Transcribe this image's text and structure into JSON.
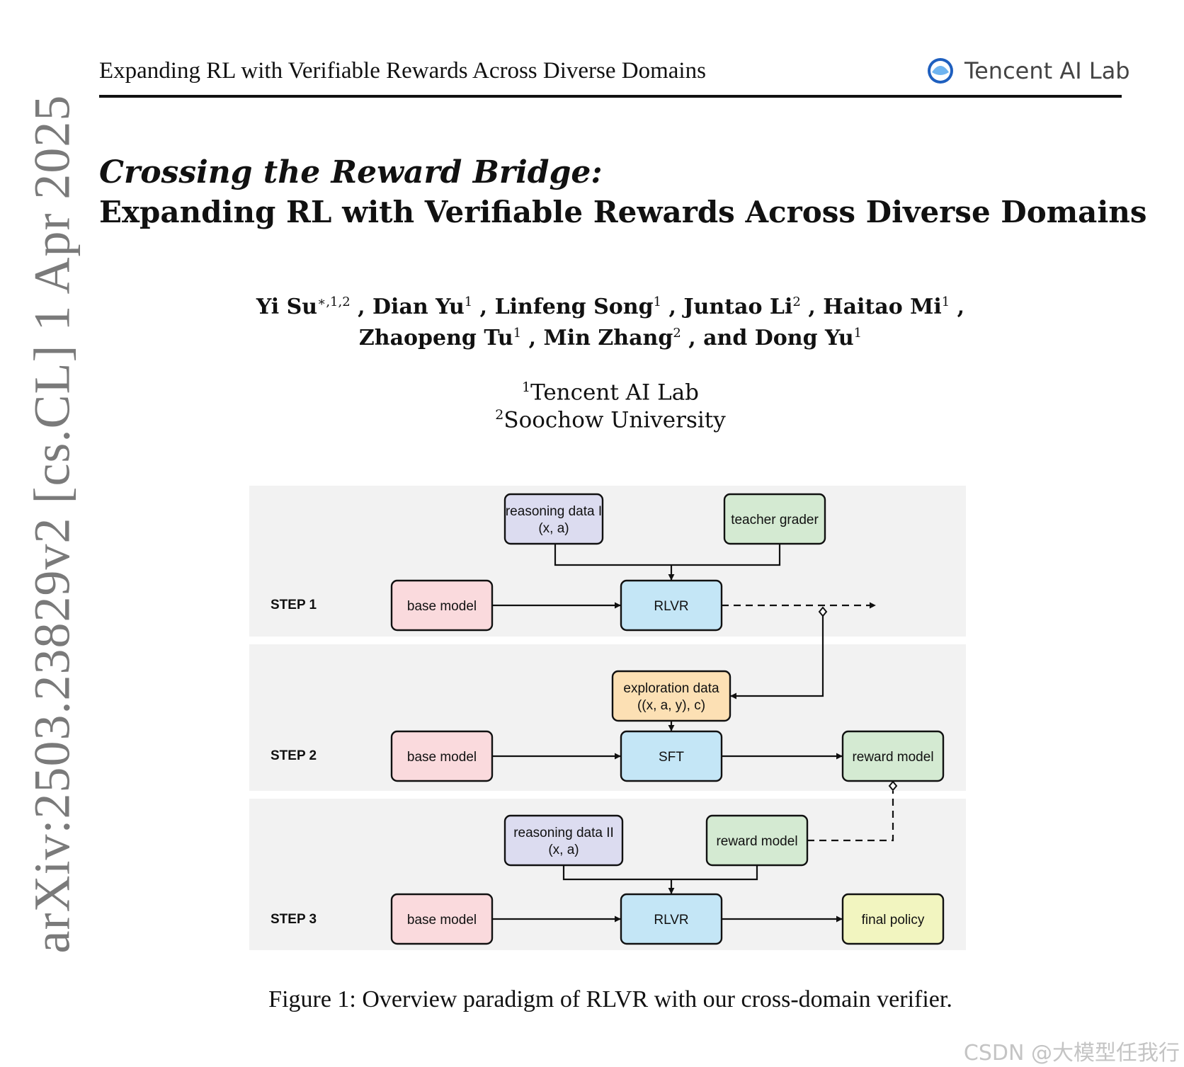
{
  "sidebar_stamp": "arXiv:2503.23829v2  [cs.CL]  1 Apr 2025",
  "header": {
    "running_title": "Expanding RL with Verifiable Rewards Across Diverse Domains",
    "brand_name": "Tencent AI Lab",
    "brand_logo_icon": "tencent-ai-lab-logo-icon"
  },
  "title": {
    "line1": "Crossing the Reward Bridge:",
    "line2": "Expanding RL with Verifiable Rewards Across Diverse Domains"
  },
  "authors": {
    "line1": [
      {
        "name": "Yi Su",
        "sup": "∗,1,2"
      },
      {
        "name": "Dian Yu",
        "sup": "1"
      },
      {
        "name": "Linfeng Song",
        "sup": "1"
      },
      {
        "name": "Juntao Li",
        "sup": "2"
      },
      {
        "name": "Haitao Mi",
        "sup": "1"
      }
    ],
    "line2": [
      {
        "name": "Zhaopeng Tu",
        "sup": "1"
      },
      {
        "name": "Min Zhang",
        "sup": "2"
      },
      {
        "name": "and Dong Yu",
        "sup": "1"
      }
    ]
  },
  "affiliations": [
    {
      "sup": "1",
      "name": "Tencent AI Lab"
    },
    {
      "sup": "2",
      "name": "Soochow University"
    }
  ],
  "figure": {
    "steps": [
      {
        "label": "STEP 1",
        "band_color": "#f2f2f2"
      },
      {
        "label": "STEP 2",
        "band_color": "#f2f2f2"
      },
      {
        "label": "STEP 3",
        "band_color": "#f2f2f2"
      }
    ],
    "nodes": [
      {
        "id": "reasoning1",
        "lines": [
          "reasoning data I",
          "(x, a)"
        ],
        "fill": "#dcdcf0"
      },
      {
        "id": "teacher",
        "lines": [
          "teacher grader"
        ],
        "fill": "#d4ead2"
      },
      {
        "id": "base1",
        "lines": [
          "base model"
        ],
        "fill": "#fadadd"
      },
      {
        "id": "rlvr1",
        "lines": [
          "RLVR"
        ],
        "fill": "#c4e6f6"
      },
      {
        "id": "explore",
        "lines": [
          "exploration data",
          "((x, a, y), c)"
        ],
        "fill": "#fce0b4"
      },
      {
        "id": "base2",
        "lines": [
          "base model"
        ],
        "fill": "#fadadd"
      },
      {
        "id": "sft",
        "lines": [
          "SFT"
        ],
        "fill": "#c4e6f6"
      },
      {
        "id": "rm2",
        "lines": [
          "reward model"
        ],
        "fill": "#d4ead2"
      },
      {
        "id": "reasoning2",
        "lines": [
          "reasoning data II",
          "(x, a)"
        ],
        "fill": "#dcdcf0"
      },
      {
        "id": "rm3",
        "lines": [
          "reward model"
        ],
        "fill": "#d4ead2"
      },
      {
        "id": "base3",
        "lines": [
          "base model"
        ],
        "fill": "#fadadd"
      },
      {
        "id": "rlvr3",
        "lines": [
          "RLVR"
        ],
        "fill": "#c4e6f6"
      },
      {
        "id": "final",
        "lines": [
          "final policy"
        ],
        "fill": "#f2f5c0"
      }
    ]
  },
  "caption": "Figure 1: Overview paradigm of RLVR with our cross-domain verifier.",
  "watermark": "CSDN @大模型任我行"
}
